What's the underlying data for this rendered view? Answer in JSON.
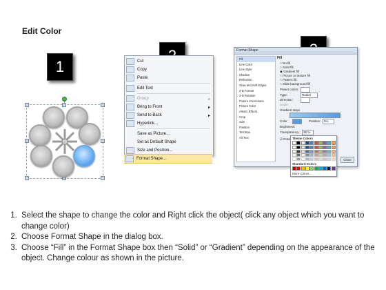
{
  "title": "Edit Color",
  "steps": {
    "one": "1",
    "two": "2",
    "three": "3"
  },
  "context_menu": {
    "items": [
      {
        "label": "Cut",
        "disabled": false
      },
      {
        "label": "Copy",
        "disabled": false
      },
      {
        "label": "Paste",
        "disabled": false
      },
      {
        "label": "Edit Text",
        "disabled": false
      },
      {
        "label": "Group",
        "disabled": true
      },
      {
        "label": "Bring to Front",
        "disabled": false
      },
      {
        "label": "Send to Back",
        "disabled": false
      },
      {
        "label": "Hyperlink...",
        "disabled": false
      },
      {
        "label": "Save as Picture...",
        "disabled": false
      },
      {
        "label": "Set as Default Shape",
        "disabled": false
      },
      {
        "label": "Size and Position...",
        "disabled": false
      },
      {
        "label": "Format Shape...",
        "disabled": false
      }
    ]
  },
  "format_dialog": {
    "title": "Format Shape",
    "categories": [
      "Fill",
      "Line Color",
      "Line Style",
      "Shadow",
      "Reflection",
      "Glow and Soft Edges",
      "3-D Format",
      "3-D Rotation",
      "Picture Corrections",
      "Picture Color",
      "Artistic Effects",
      "Crop",
      "Size",
      "Position",
      "Text Box",
      "Alt Text"
    ],
    "fill_heading": "Fill",
    "fill_options": [
      "No fill",
      "Solid fill",
      "Gradient fill",
      "Picture or texture fill",
      "Pattern fill",
      "Slide background fill"
    ],
    "preset_colors": "Preset colors:",
    "type_label": "Type:",
    "type_value": "Radial",
    "direction_label": "Direction:",
    "angle_label": "Angle:",
    "gradient_stops": "Gradient stops",
    "color_label": "Color",
    "position_label": "Position:",
    "position_value": "0%",
    "brightness_label": "Brightness:",
    "transparency_label": "Transparency:",
    "transparency_value": "36 %",
    "rotate_label": "Rotate with shape",
    "theme_colors": "Theme Colors",
    "standard_colors": "Standard Colors",
    "more_colors": "More Colors...",
    "close": "Close",
    "standard_swatches": [
      "#c00000",
      "#ff0000",
      "#ffc000",
      "#ffff00",
      "#92d050",
      "#00b050",
      "#00b0f0",
      "#0070c0",
      "#002060",
      "#7030a0"
    ],
    "theme_top": [
      "#ffffff",
      "#000000",
      "#eeece1",
      "#1f497d",
      "#4f81bd",
      "#c0504d",
      "#9bbb59",
      "#8064a2",
      "#4bacc6",
      "#f79646"
    ]
  },
  "instructions": [
    "Select the shape to change the color and Right click the object( click any object which you want to change color)",
    "Choose Format Shape in the dialog box.",
    "Choose “Fill” in the Format Shape box then “Solid” or “Gradient” depending on the appearance of the object. Change colour as shown in the picture."
  ]
}
